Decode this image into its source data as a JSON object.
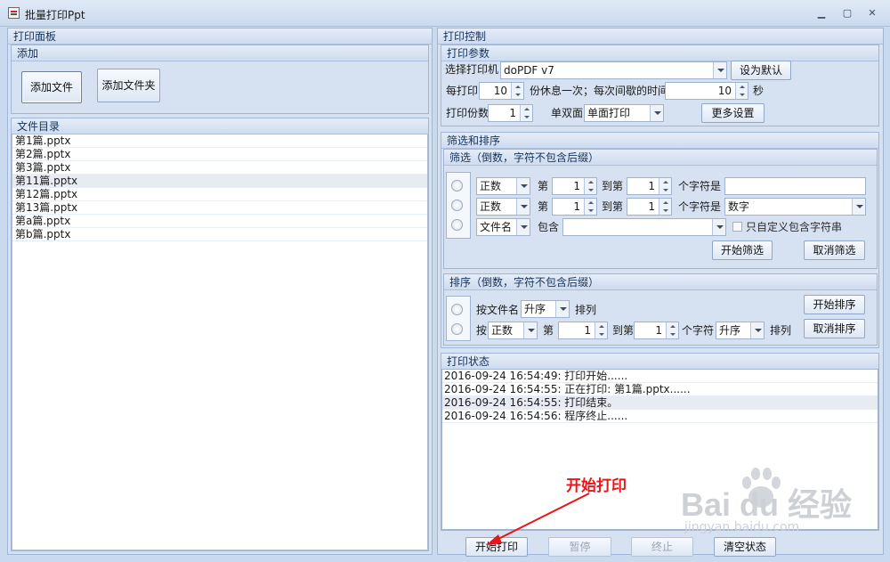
{
  "window": {
    "title": "批量打印Ppt",
    "controls": [
      "▁",
      "▢",
      "✕"
    ]
  },
  "left_panel": {
    "title": "打印面板",
    "add_group": {
      "title": "添加",
      "add_file": "添加文件",
      "add_folder": "添加文件夹"
    },
    "file_list": {
      "title": "文件目录",
      "items": [
        "第1篇.pptx",
        "第2篇.pptx",
        "第3篇.pptx",
        "第11篇.pptx",
        "第12篇.pptx",
        "第13篇.pptx",
        "第a篇.pptx",
        "第b篇.pptx"
      ],
      "selected_index": 3
    }
  },
  "right_panel": {
    "title": "打印控制",
    "params": {
      "title": "打印参数",
      "printer_label": "选择打印机",
      "printer_value": "doPDF v7",
      "set_default": "设为默认",
      "per_print_label": "每打印",
      "per_print_value": "10",
      "rest_label": "份休息一次；每次间歇的时间",
      "rest_value": "10",
      "seconds_label": "秒",
      "copies_label": "打印份数",
      "copies_value": "1",
      "duplex_label": "单双面",
      "duplex_value": "单面打印",
      "more_settings": "更多设置"
    },
    "filter_sort": {
      "title": "筛选和排序",
      "filter": {
        "title": "筛选（倒数，字符不包含后缀）",
        "row1": {
          "mode": "正数",
          "di": "第",
          "from": "1",
          "to_label": "到第",
          "to": "1",
          "chars_label": "个字符是",
          "value": ""
        },
        "row2": {
          "mode": "正数",
          "di": "第",
          "from": "1",
          "to_label": "到第",
          "to": "1",
          "chars_label": "个字符是",
          "value": "数字"
        },
        "row3": {
          "mode": "文件名",
          "contains_label": "包含",
          "value": "",
          "custom_only_label": "只自定义包含字符串"
        },
        "start": "开始筛选",
        "cancel": "取消筛选"
      },
      "sort": {
        "title": "排序（倒数，字符不包含后缀）",
        "row1": {
          "by_name_label": "按文件名",
          "order": "升序",
          "arrange_label": "排列"
        },
        "row2": {
          "by_label": "按",
          "mode": "正数",
          "di": "第",
          "from": "1",
          "to_label": "到第",
          "to": "1",
          "chars_label": "个字符",
          "order": "升序",
          "arrange_label": "排列"
        },
        "start": "开始排序",
        "cancel": "取消排序"
      }
    },
    "status": {
      "title": "打印状态",
      "log": [
        "2016-09-24 16:54:49: 打印开始......",
        "2016-09-24 16:54:55: 正在打印: 第1篇.pptx......",
        "2016-09-24 16:54:55: 打印结束。",
        "2016-09-24 16:54:56: 程序终止......"
      ],
      "selected_index": 2
    },
    "bottom_buttons": {
      "start": "开始打印",
      "pause": "暂停",
      "stop": "终止",
      "clear": "清空状态"
    }
  },
  "annotation": {
    "text": "开始打印",
    "color": "#e8161b"
  },
  "watermark": {
    "brand": "Bai du 经验",
    "url": "jingyan.baidu.com"
  }
}
